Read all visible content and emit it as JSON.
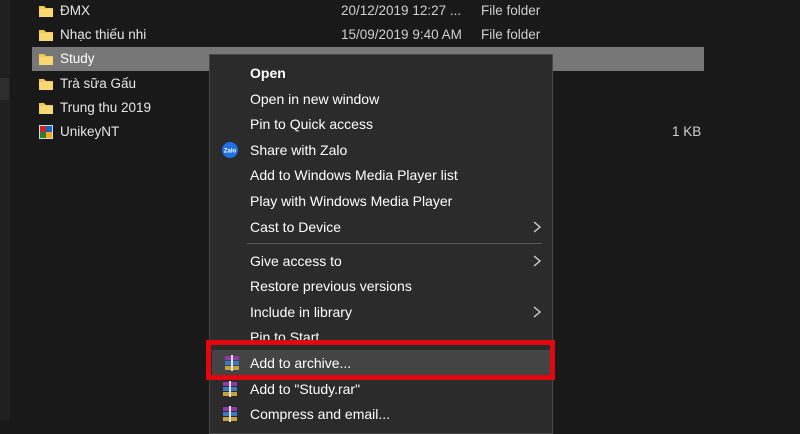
{
  "files": [
    {
      "name": "ĐMX",
      "date": "20/12/2019 12:27 ...",
      "type": "File folder",
      "size": "",
      "icon": "folder-icon"
    },
    {
      "name": "Nhạc thiếu nhi",
      "date": "15/09/2019 9:40 AM",
      "type": "File folder",
      "size": "",
      "icon": "folder-icon"
    },
    {
      "name": "Study",
      "date": "",
      "type": "",
      "size": "",
      "icon": "folder-icon",
      "selected": true
    },
    {
      "name": "Trà sữa Gấu",
      "date": "",
      "type": "",
      "size": "",
      "icon": "folder-icon"
    },
    {
      "name": "Trung thu 2019",
      "date": "",
      "type": "",
      "size": "",
      "icon": "folder-icon"
    },
    {
      "name": "UnikeyNT",
      "date": "",
      "type": "",
      "size": "1 KB",
      "icon": "unikey-app-icon"
    }
  ],
  "context_menu": {
    "items": [
      {
        "label": "Open",
        "bold": true
      },
      {
        "label": "Open in new window"
      },
      {
        "label": "Pin to Quick access"
      },
      {
        "label": "Share with Zalo",
        "icon": "zalo-icon",
        "icon_text": "Zalo"
      },
      {
        "label": "Add to Windows Media Player list"
      },
      {
        "label": "Play with Windows Media Player"
      },
      {
        "label": "Cast to Device",
        "submenu": true
      },
      {
        "label": "Give access to",
        "submenu": true
      },
      {
        "label": "Restore previous versions"
      },
      {
        "label": "Include in library",
        "submenu": true
      },
      {
        "label": "Pin to Start"
      },
      {
        "label": "Add to archive...",
        "icon": "winrar-icon",
        "highlighted": true
      },
      {
        "label": "Add to \"Study.rar\"",
        "icon": "winrar-icon"
      },
      {
        "label": "Compress and email...",
        "icon": "winrar-icon"
      }
    ]
  },
  "colors": {
    "background": "#191919",
    "menu_background": "#2b2b2b",
    "selected_row": "#777777",
    "highlight_box": "#e0070f",
    "folder_yellow": "#f3c94a",
    "zalo_blue": "#1f6fe5"
  }
}
